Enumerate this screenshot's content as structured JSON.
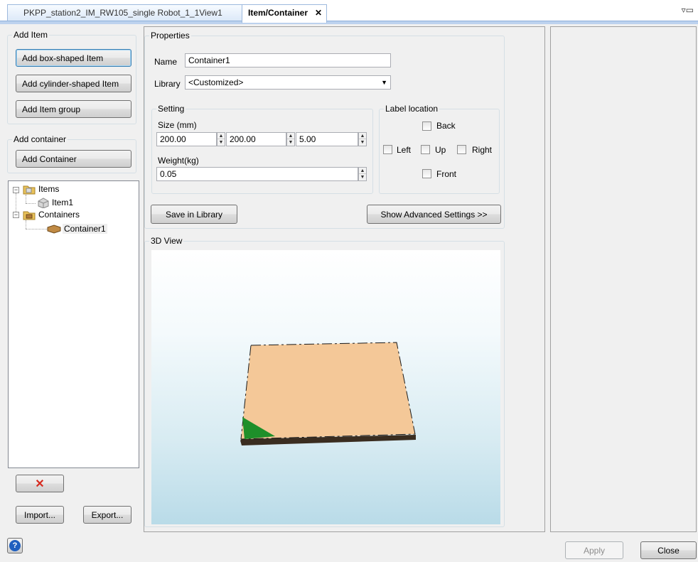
{
  "tabs": [
    {
      "label": "PKPP_station2_IM_RW105_single Robot_1_1View1",
      "active": false
    },
    {
      "label": "Item/Container",
      "active": true,
      "close_glyph": "✕"
    }
  ],
  "window_controls": "▿▭",
  "left_panel": {
    "add_item_title": "Add Item",
    "add_box_button": "Add box-shaped Item",
    "add_cylinder_button": "Add cylinder-shaped Item",
    "add_group_button": "Add Item group",
    "add_container_title": "Add container",
    "add_container_button": "Add Container",
    "tree": {
      "items_label": "Items",
      "item1_label": "Item1",
      "containers_label": "Containers",
      "container1_label": "Container1"
    },
    "delete_glyph": "✕",
    "import_button": "Import...",
    "export_button": "Export...",
    "help_glyph": "?"
  },
  "properties": {
    "title": "Properties",
    "name_label": "Name",
    "name_value": "Container1",
    "library_label": "Library",
    "library_value": "<Customized>",
    "setting_title": "Setting",
    "size_label": "Size (mm)",
    "size_values": [
      "200.00",
      "200.00",
      "5.00"
    ],
    "weight_label": "Weight(kg)",
    "weight_value": "0.05",
    "label_location_title": "Label location",
    "back_label": "Back",
    "left_label": "Left",
    "up_label": "Up",
    "right_label": "Right",
    "front_label": "Front",
    "save_library_button": "Save in Library",
    "show_advanced_button": "Show Advanced Settings >>"
  },
  "view3d": {
    "title": "3D View",
    "box_color": "#f4c898",
    "marker_color": "#1e8f2a"
  },
  "footer": {
    "apply_button": "Apply",
    "close_button": "Close"
  },
  "colors": {
    "tab_rail": "#bcd2ee",
    "delete_icon": "#d62b1f",
    "help_icon": "#1f5fbf"
  }
}
